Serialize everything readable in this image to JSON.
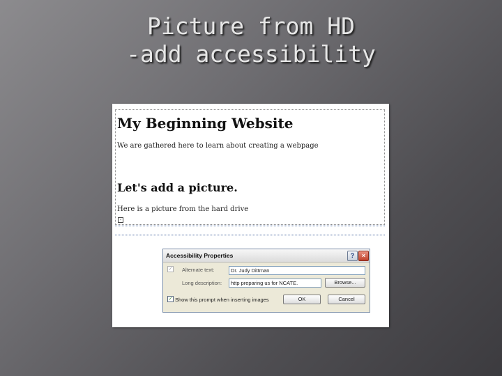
{
  "slide": {
    "title_line1": "Picture from HD",
    "title_line2": "-add accessibility"
  },
  "website": {
    "heading": "My Beginning Website",
    "intro": "We are gathered here to learn about creating a webpage",
    "subheading": "Let's add a picture.",
    "picture_note": "Here is a picture from the hard drive"
  },
  "dialog": {
    "title": "Accessibility Properties",
    "help_label": "?",
    "close_label": "×",
    "alt_text_label": "Alternate text:",
    "alt_text_value": "Dr. Judy Dittman",
    "long_desc_label": "Long description:",
    "long_desc_value": "http preparing us for NCATE.",
    "browse_label": "Browse...",
    "show_prompt_label": "Show this prompt when inserting images",
    "ok_label": "OK",
    "cancel_label": "Cancel"
  },
  "icons": {
    "alt_checkbox": "check-icon",
    "show_prompt_checkbox": "check-icon",
    "image_placeholder": "broken-image-icon"
  },
  "colors": {
    "slide_bg": "#6f6e72",
    "title_text": "#e6e6e6",
    "close_button": "#c0402a"
  }
}
